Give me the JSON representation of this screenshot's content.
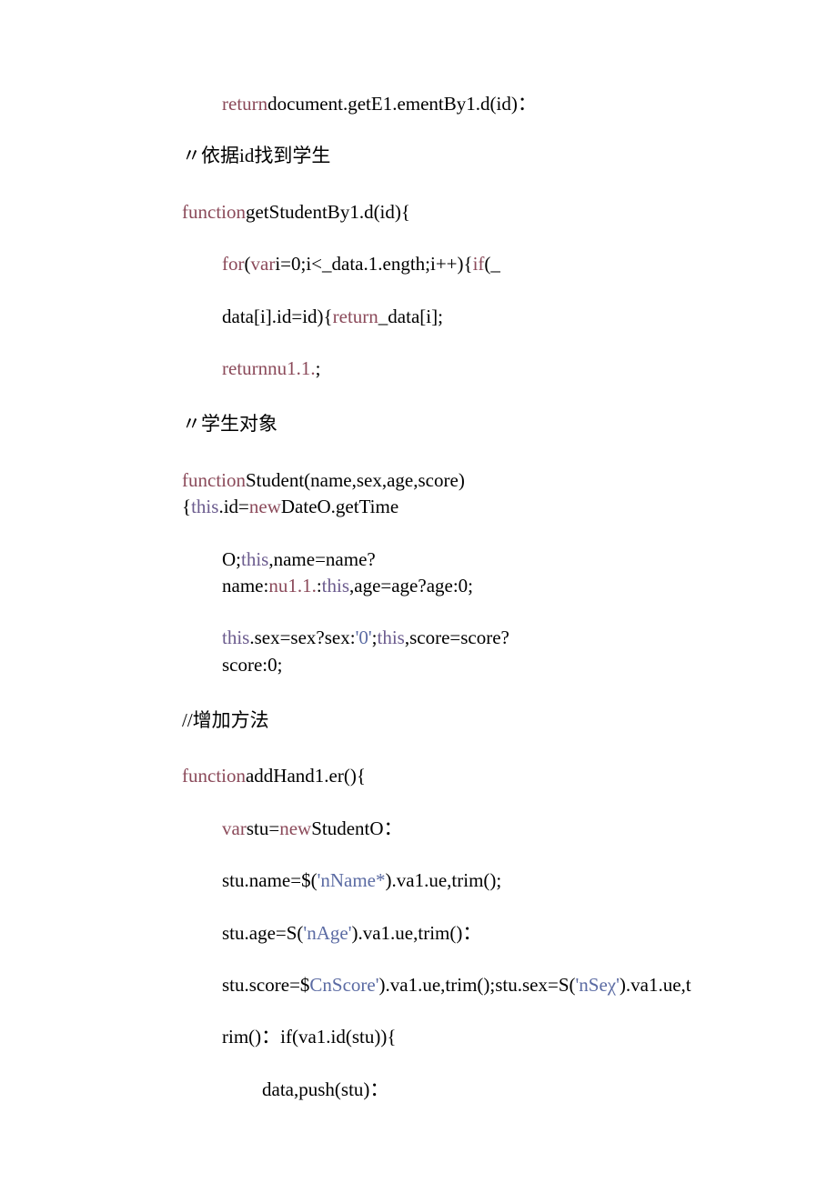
{
  "lines": [
    {
      "indent": 1,
      "parts": [
        {
          "t": "return",
          "c": "kw"
        },
        {
          "t": "document.getE1.ementBy1.d(id)："
        }
      ]
    },
    {
      "indent": 0,
      "parts": [
        {
          "t": "〃依据id找到学生"
        }
      ]
    },
    {
      "indent": 0,
      "gap": true,
      "parts": [
        {
          "t": "function",
          "c": "kw"
        },
        {
          "t": "getStudentBy1.d(id){"
        }
      ]
    },
    {
      "indent": 1,
      "parts": [
        {
          "t": "for",
          "c": "kw"
        },
        {
          "t": "("
        },
        {
          "t": "var",
          "c": "kw"
        },
        {
          "t": "i=0;i<_data.1.ength;i++){"
        },
        {
          "t": "if",
          "c": "kw"
        },
        {
          "t": "(_"
        }
      ]
    },
    {
      "indent": 1,
      "parts": [
        {
          "t": "data[i].id=id){"
        },
        {
          "t": "return",
          "c": "kw"
        },
        {
          "t": "_data[i];"
        }
      ]
    },
    {
      "indent": 1,
      "parts": [
        {
          "t": "returnnu1.1.",
          "c": "kw"
        },
        {
          "t": ";"
        }
      ]
    },
    {
      "indent": 0,
      "gap": true,
      "parts": [
        {
          "t": "〃学生对象"
        }
      ]
    },
    {
      "indent": 0,
      "gap": true,
      "parts": [
        {
          "t": "function",
          "c": "kw"
        },
        {
          "t": "Student(name,sex,age,score){"
        },
        {
          "t": "this",
          "c": "prop"
        },
        {
          "t": ".id="
        },
        {
          "t": "new",
          "c": "kw"
        },
        {
          "t": "DateO.getTime"
        }
      ]
    },
    {
      "indent": 1,
      "parts": [
        {
          "t": "O;"
        },
        {
          "t": "this",
          "c": "prop"
        },
        {
          "t": ",name=name?name:"
        },
        {
          "t": "nu1.1.",
          "c": "kw"
        },
        {
          "t": ":"
        },
        {
          "t": "this",
          "c": "prop"
        },
        {
          "t": ",age=age?age:0;"
        }
      ]
    },
    {
      "indent": 1,
      "parts": [
        {
          "t": "this",
          "c": "prop"
        },
        {
          "t": ".sex=sex?sex:"
        },
        {
          "t": "'0'",
          "c": "str"
        },
        {
          "t": ";"
        },
        {
          "t": "this",
          "c": "prop"
        },
        {
          "t": ",score=score?score:0;"
        }
      ]
    },
    {
      "indent": 0,
      "gap": true,
      "parts": [
        {
          "t": "//增加方法"
        }
      ]
    },
    {
      "indent": 0,
      "gap": true,
      "parts": [
        {
          "t": "function",
          "c": "kw"
        },
        {
          "t": "addHand1.er(){"
        }
      ]
    },
    {
      "indent": 1,
      "parts": [
        {
          "t": "var",
          "c": "kw"
        },
        {
          "t": "stu="
        },
        {
          "t": "new",
          "c": "kw"
        },
        {
          "t": "StudentO："
        }
      ]
    },
    {
      "indent": 1,
      "parts": [
        {
          "t": "stu.name=$("
        },
        {
          "t": "'nName*",
          "c": "str"
        },
        {
          "t": ").va1.ue,trim();"
        }
      ]
    },
    {
      "indent": 1,
      "parts": [
        {
          "t": "stu.age=S("
        },
        {
          "t": "'nAge'",
          "c": "str"
        },
        {
          "t": ").va1.ue,trim()："
        }
      ]
    },
    {
      "indent": 1,
      "parts": [
        {
          "t": "stu.score=$"
        },
        {
          "t": "CnScore'",
          "c": "str"
        },
        {
          "t": ").va1.ue,trim();stu.sex=S("
        },
        {
          "t": "'nSeχ'",
          "c": "str"
        },
        {
          "t": ").va1.ue,t"
        }
      ]
    },
    {
      "indent": 1,
      "parts": [
        {
          "t": "rim()：if(va1.id(stu)){"
        }
      ]
    },
    {
      "indent": 2,
      "parts": [
        {
          "t": "data,push(stu)："
        }
      ]
    }
  ]
}
